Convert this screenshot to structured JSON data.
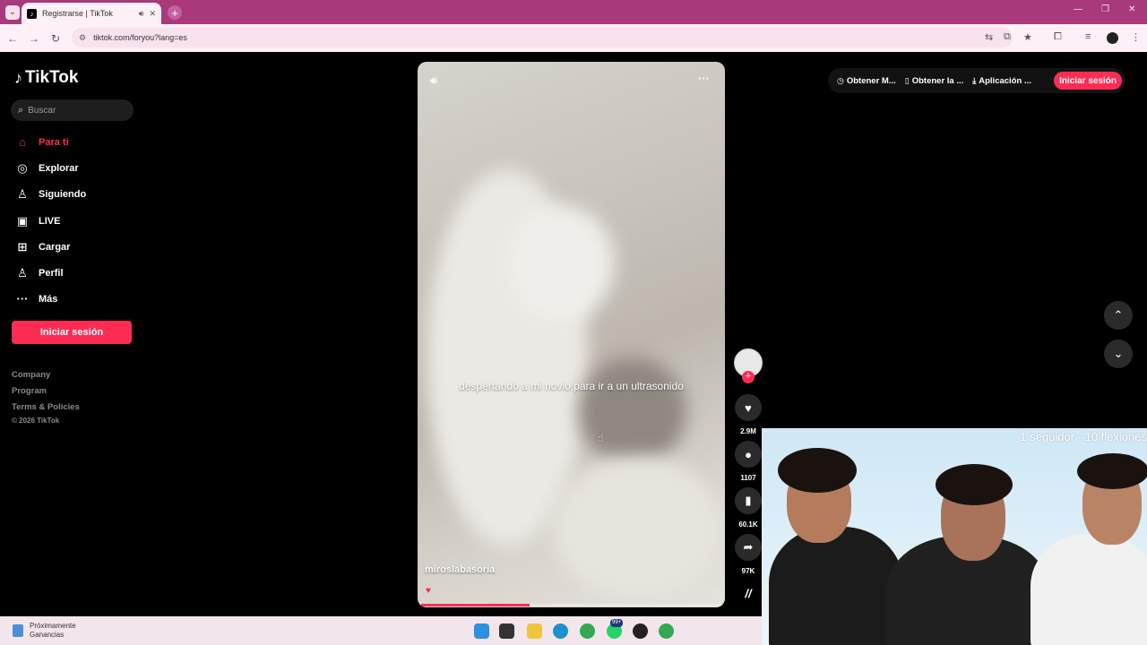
{
  "browser": {
    "tab_title": "Registrarse | TikTok",
    "url": "tiktok.com/foryou?lang=es"
  },
  "sidebar": {
    "logo": "TikTok",
    "search_placeholder": "Buscar",
    "items": [
      {
        "label": "Para ti",
        "icon": "home-icon"
      },
      {
        "label": "Explorar",
        "icon": "compass-icon"
      },
      {
        "label": "Siguiendo",
        "icon": "user-icon"
      },
      {
        "label": "LIVE",
        "icon": "tv-icon"
      },
      {
        "label": "Cargar",
        "icon": "plus-square-icon"
      },
      {
        "label": "Perfil",
        "icon": "user-icon"
      },
      {
        "label": "Más",
        "icon": "more-icon"
      }
    ],
    "login_button": "Iniciar sesión",
    "footer_links": [
      "Company",
      "Program",
      "Terms & Policies"
    ],
    "copyright": "© 2026 TikTok"
  },
  "video": {
    "caption": "despertando a mi novio para ir a un ultrasonido",
    "author": "miroslabasoria",
    "progress": 0.36
  },
  "actions": {
    "likes": "2.9M",
    "comments": "1107",
    "saves": "60.1K",
    "shares": "97K"
  },
  "topbar": {
    "get_coins": "Obtener M...",
    "get_app": "Obtener la ...",
    "desktop_app": "Aplicación ...",
    "login": "Iniciar sesión"
  },
  "webcam": {
    "overlay_text": "1 seguidor - 10 flexiones"
  },
  "taskbar": {
    "widget_line1": "Próximamente",
    "widget_line2": "Ganancias",
    "badge": "99+"
  }
}
